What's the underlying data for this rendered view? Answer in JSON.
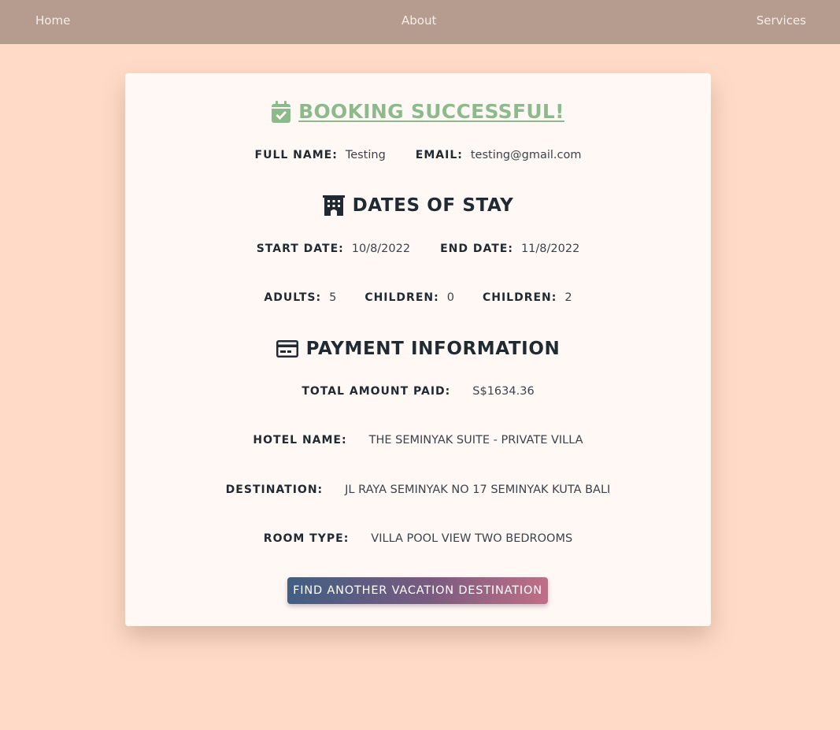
{
  "nav": {
    "home": "Home",
    "about": "About",
    "services": "Services"
  },
  "success": {
    "title": "BOOKING SUCCESSFUL!",
    "icon": "calendar-check-icon",
    "color": "#8dba8c"
  },
  "guest": {
    "name_label": "FULL NAME:",
    "name_value": "Testing",
    "email_label": "EMAIL:",
    "email_value": "testing@gmail.com"
  },
  "stay": {
    "heading": "DATES OF STAY",
    "icon": "hotel-icon",
    "start_label": "START DATE:",
    "start_value": "10/8/2022",
    "end_label": "END DATE:",
    "end_value": "11/8/2022"
  },
  "guests": {
    "adults_label": "ADULTS:",
    "adults_value": "5",
    "children_label": "CHILDREN:",
    "children_value": "0",
    "children2_label": "CHILDREN:",
    "children2_value": "2"
  },
  "payment": {
    "heading": "PAYMENT INFORMATION",
    "icon": "credit-card-icon",
    "total_label": "TOTAL AMOUNT PAID:",
    "total_value": "S$1634.36",
    "hotel_label": "HOTEL NAME:",
    "hotel_value": "THE SEMINYAK SUITE - PRIVATE VILLA",
    "destination_label": "DESTINATION:",
    "destination_value": "JL RAYA SEMINYAK NO 17 SEMINYAK KUTA BALI",
    "room_label": "ROOM TYPE:",
    "room_value": "VILLA POOL VIEW TWO BEDROOMS"
  },
  "cta": {
    "label": "FIND ANOTHER VACATION DESTINATION"
  },
  "colors": {
    "background": "#ffdbc7",
    "navbar": "#b69b8f",
    "card": "#fff8f5",
    "button_start": "#415e83",
    "button_end": "#c16f86"
  }
}
